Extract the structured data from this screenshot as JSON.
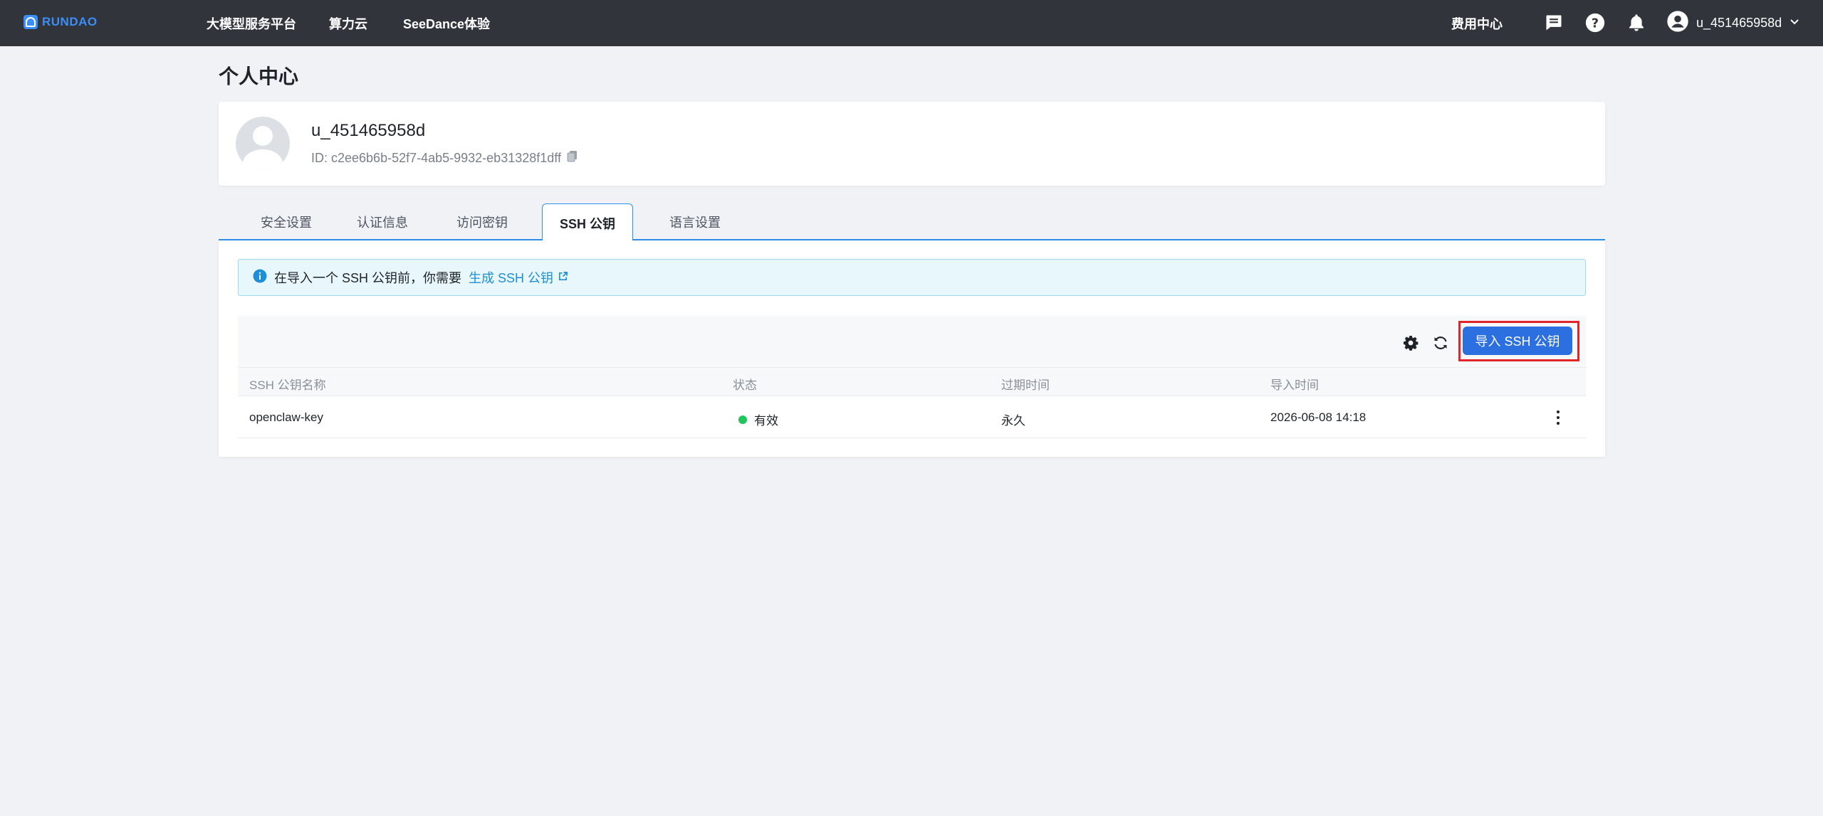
{
  "brand": {
    "name": "RUNDAO",
    "color": "#3a8ef6"
  },
  "nav": {
    "items": [
      "大模型服务平台",
      "算力云",
      "SeeDance体验"
    ],
    "billing": "费用中心",
    "icons": [
      "message-icon",
      "help-icon",
      "bell-icon"
    ],
    "username": "u_451465958d"
  },
  "page": {
    "title": "个人中心"
  },
  "profile": {
    "username": "u_451465958d",
    "id_text": "ID: c2ee6b6b-52f7-4ab5-9932-eb31328f1dff"
  },
  "tabs": [
    {
      "label": "安全设置",
      "active": false
    },
    {
      "label": "认证信息",
      "active": false
    },
    {
      "label": "访问密钥",
      "active": false
    },
    {
      "label": "SSH 公钥",
      "active": true
    },
    {
      "label": "语言设置",
      "active": false
    }
  ],
  "alert": {
    "text": "在导入一个 SSH 公钥前，你需要",
    "link": "生成 SSH 公钥"
  },
  "toolbar": {
    "import_label": "导入 SSH 公钥"
  },
  "table": {
    "columns": [
      "SSH 公钥名称",
      "状态",
      "过期时间",
      "导入时间"
    ],
    "rows": [
      {
        "name": "openclaw-key",
        "status": "有效",
        "expire": "永久",
        "imported": "2026-06-08 14:18"
      }
    ]
  },
  "colors": {
    "topbar": "#31353b",
    "accent": "#2b6fe0",
    "status_ok": "#21c45d",
    "highlight": "#e1252b"
  }
}
